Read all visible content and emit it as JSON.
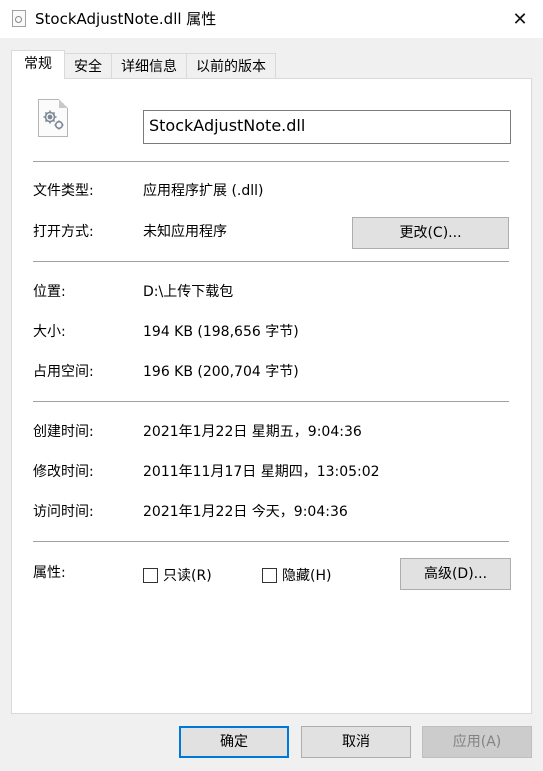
{
  "window": {
    "title": "StockAdjustNote.dll 属性",
    "close_glyph": "✕"
  },
  "tabs": [
    {
      "label": "常规",
      "active": true
    },
    {
      "label": "安全",
      "active": false
    },
    {
      "label": "详细信息",
      "active": false
    },
    {
      "label": "以前的版本",
      "active": false
    }
  ],
  "general": {
    "file_name": "StockAdjustNote.dll",
    "file_type_label": "文件类型:",
    "file_type_value": "应用程序扩展 (.dll)",
    "opens_with_label": "打开方式:",
    "opens_with_value": "未知应用程序",
    "change_button": "更改(C)...",
    "location_label": "位置:",
    "location_value": "D:\\上传下载包",
    "size_label": "大小:",
    "size_value": "194 KB (198,656 字节)",
    "size_on_disk_label": "占用空间:",
    "size_on_disk_value": "196 KB (200,704 字节)",
    "created_label": "创建时间:",
    "created_value": "2021年1月22日 星期五，9:04:36",
    "modified_label": "修改时间:",
    "modified_value": "2011年11月17日 星期四，13:05:02",
    "accessed_label": "访问时间:",
    "accessed_value": "2021年1月22日 今天，9:04:36",
    "attributes_label": "属性:",
    "readonly_label": "只读(R)",
    "readonly_checked": false,
    "hidden_label": "隐藏(H)",
    "hidden_checked": false,
    "advanced_button": "高级(D)..."
  },
  "footer": {
    "ok_button": "确定",
    "cancel_button": "取消",
    "apply_button": "应用(A)"
  },
  "colors": {
    "accent": "#0078d7",
    "panel_bg": "#ffffff",
    "window_bg": "#f0f0f0"
  },
  "icons": {
    "title_icon": "dll-file-icon",
    "file_icon": "gear-file-icon"
  }
}
